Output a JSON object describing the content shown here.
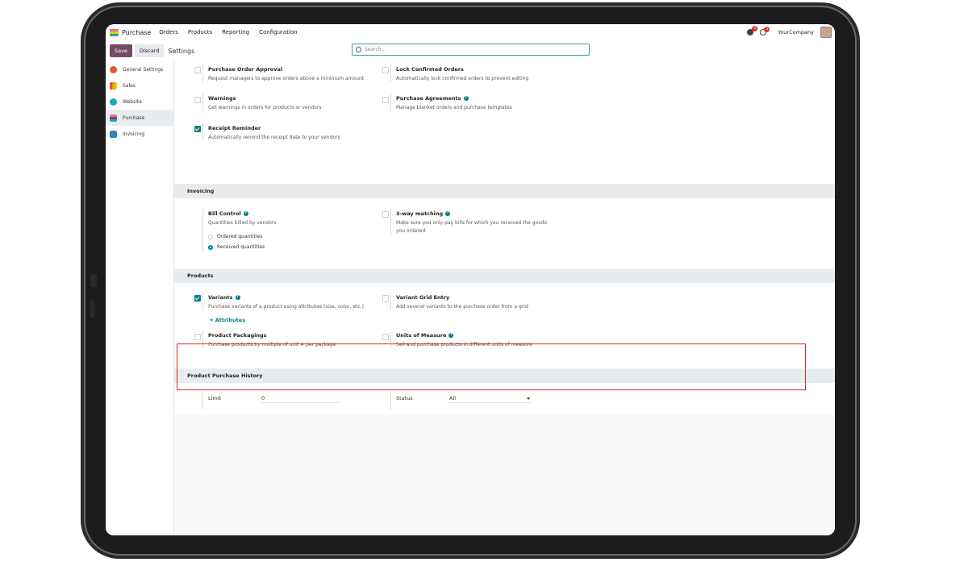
{
  "topbar": {
    "app_name": "Purchase",
    "menus": [
      "Orders",
      "Products",
      "Reporting",
      "Configuration"
    ],
    "messages_badge": "6",
    "activities_badge": "5",
    "company": "YourCompany"
  },
  "control": {
    "save_label": "Save",
    "discard_label": "Discard",
    "title": "Settings",
    "search_placeholder": "Search..."
  },
  "sidebar": {
    "items": [
      {
        "label": "General Settings",
        "color": "#e4572e"
      },
      {
        "label": "Sales",
        "color": "#f39c12"
      },
      {
        "label": "Website",
        "color": "#1ea9b6"
      },
      {
        "label": "Purchase",
        "color": "#714b67"
      },
      {
        "label": "Invoicing",
        "color": "#2e86c1"
      }
    ],
    "active": "Purchase"
  },
  "orders_settings": [
    {
      "label": "Purchase Order Approval",
      "desc": "Request managers to approve orders above a minimum amount",
      "checked": false
    },
    {
      "label": "Lock Confirmed Orders",
      "desc": "Automatically lock confirmed orders to prevent editing",
      "checked": false
    },
    {
      "label": "Warnings",
      "desc": "Get warnings in orders for products or vendors",
      "checked": false
    },
    {
      "label": "Purchase Agreements",
      "desc": "Manage blanket orders and purchase templates",
      "checked": false,
      "help": "?"
    },
    {
      "label": "Receipt Reminder",
      "desc": "Automatically remind the receipt date to your vendors",
      "checked": true
    }
  ],
  "invoicing": {
    "section_title": "Invoicing",
    "bill_control": {
      "label": "Bill Control",
      "help": "?",
      "desc": "Quantities billed by vendors",
      "options": [
        "Ordered quantities",
        "Received quantities"
      ],
      "selected": "Received quantities"
    },
    "three_way": {
      "label": "3-way matching",
      "help": "?",
      "desc_line1": "Make sure you only pay bills for which you received the goods",
      "desc_line2": "you ordered",
      "checked": false
    }
  },
  "products": {
    "section_title": "Products",
    "variants": {
      "label": "Variants",
      "help": "?",
      "desc": "Purchase variants of a product using attributes (size, color, etc.)",
      "checked": true,
      "link": "Attributes",
      "link_arrow": "➔"
    },
    "variant_grid": {
      "label": "Variant Grid Entry",
      "desc": "Add several variants to the purchase order from a grid",
      "checked": false
    },
    "packagings": {
      "label": "Product Packagings",
      "desc": "Purchase products by multiple of unit # per package",
      "checked": false
    },
    "uom": {
      "label": "Units of Measure",
      "help": "?",
      "desc": "Sell and purchase products in different units of measure",
      "checked": false
    }
  },
  "history": {
    "section_title": "Product Purchase History",
    "limit_label": "Limit",
    "limit_value": "0",
    "status_label": "Status",
    "status_value": "All"
  }
}
